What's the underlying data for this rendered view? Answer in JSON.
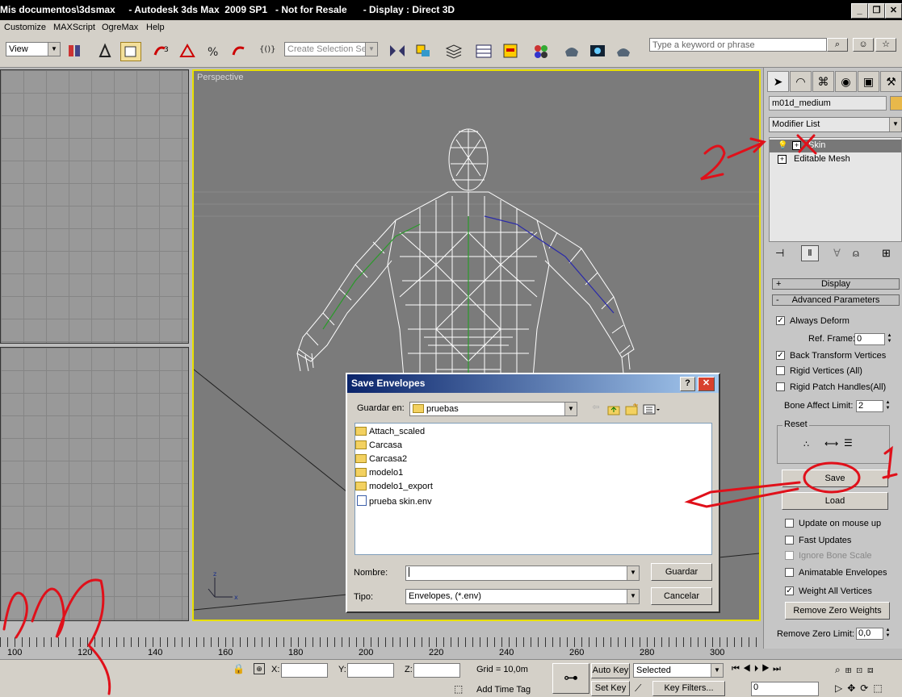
{
  "window": {
    "title": "Mis documentos\\3dsmax     - Autodesk 3ds Max  2009 SP1   - Not for Resale      - Display : Direct 3D"
  },
  "menu": [
    "Customize",
    "MAXScript",
    "OgreMax",
    "Help"
  ],
  "toolbar": {
    "view_dropdown": "View",
    "selection_set_placeholder": "Create Selection Set",
    "search_placeholder": "Type a keyword or phrase"
  },
  "viewport": {
    "label": "Perspective"
  },
  "command_panel": {
    "object_name": "m01d_medium",
    "modifier_list": "Modifier List",
    "modifier_stack": [
      "Skin",
      "Editable Mesh"
    ],
    "rollouts": {
      "display": "Display",
      "advanced": "Advanced Parameters"
    },
    "always_deform": "Always Deform",
    "ref_frame_label": "Ref. Frame:",
    "ref_frame_value": "0",
    "back_transform": "Back Transform Vertices",
    "rigid_vertices": "Rigid Vertices (All)",
    "rigid_patch": "Rigid Patch Handles(All)",
    "bone_affect_label": "Bone Affect Limit:",
    "bone_affect_value": "2",
    "reset_label": "Reset",
    "save_button": "Save",
    "load_button": "Load",
    "update_on_mouse_up": "Update on mouse up",
    "fast_updates": "Fast Updates",
    "ignore_bone_scale": "Ignore Bone Scale",
    "animatable_envelopes": "Animatable Envelopes",
    "weight_all_vertices": "Weight All Vertices",
    "remove_zero_weights": "Remove Zero Weights",
    "remove_zero_limit_label": "Remove Zero Limit:",
    "remove_zero_limit_value": "0,0"
  },
  "dialog": {
    "title": "Save Envelopes",
    "save_in_label": "Guardar en:",
    "save_in_value": "pruebas",
    "files": [
      {
        "name": "Attach_scaled",
        "type": "folder"
      },
      {
        "name": "Carcasa",
        "type": "folder"
      },
      {
        "name": "Carcasa2",
        "type": "folder"
      },
      {
        "name": "modelo1",
        "type": "folder"
      },
      {
        "name": "modelo1_export",
        "type": "folder"
      },
      {
        "name": "prueba skin.env",
        "type": "file"
      }
    ],
    "name_label": "Nombre:",
    "name_value": "",
    "type_label": "Tipo:",
    "type_value": "Envelopes, (*.env)",
    "save_button": "Guardar",
    "cancel_button": "Cancelar"
  },
  "timeline": {
    "ticks": [
      "100",
      "120",
      "140",
      "160",
      "180",
      "200",
      "220",
      "240",
      "260",
      "280",
      "300"
    ]
  },
  "status": {
    "x_label": "X:",
    "y_label": "Y:",
    "z_label": "Z:",
    "grid": "Grid = 10,0m",
    "add_time_tag": "Add Time Tag",
    "auto_key": "Auto Key",
    "set_key": "Set Key",
    "selected": "Selected",
    "key_filters": "Key Filters...",
    "frame_value": "0"
  },
  "annotations": [
    "2",
    "1"
  ],
  "colors": {
    "viewport_border": "#e8e000",
    "annotation": "#e0101a",
    "wire": "#ffffff"
  }
}
